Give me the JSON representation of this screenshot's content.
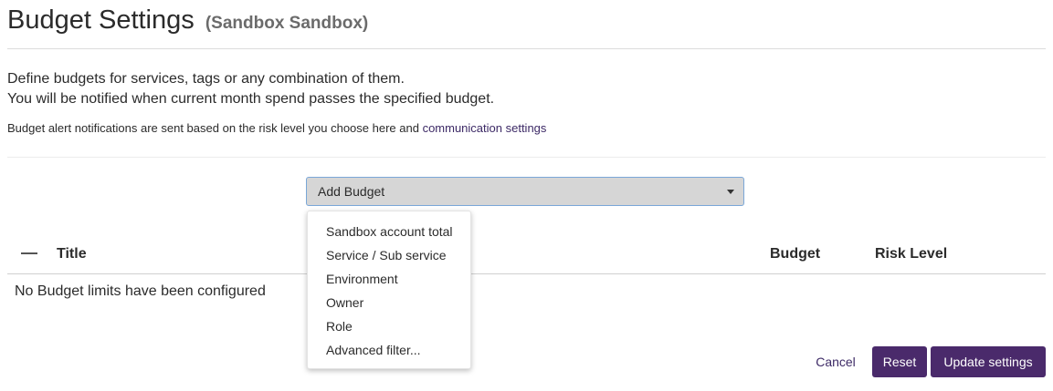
{
  "header": {
    "title": "Budget Settings",
    "subtitle": "(Sandbox Sandbox)"
  },
  "description": {
    "line1": "Define budgets for services, tags or any combination of them.",
    "line2": "You will be notified when current month spend passes the specified budget.",
    "note_prefix": "Budget alert notifications are sent based on the risk level you choose here and ",
    "note_link": "communication settings"
  },
  "add_budget": {
    "label": "Add Budget",
    "options": [
      "Sandbox account total",
      "Service / Sub service",
      "Environment",
      "Owner",
      "Role",
      "Advanced filter..."
    ]
  },
  "table": {
    "columns": {
      "title": "Title",
      "budget": "Budget",
      "risk": "Risk Level"
    },
    "empty_message": "No Budget limits have been configured"
  },
  "actions": {
    "cancel": "Cancel",
    "reset": "Reset",
    "update": "Update settings"
  },
  "colors": {
    "primary": "#4a2a6b",
    "link": "#3d2a66",
    "select_bg": "#d6d6d6",
    "select_border": "#7aa7d8"
  }
}
